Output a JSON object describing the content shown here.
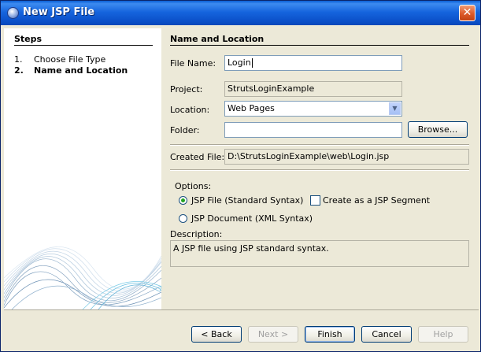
{
  "window": {
    "title": "New JSP File",
    "close_label": "✕"
  },
  "steps": {
    "title": "Steps",
    "items": [
      {
        "num": "1.",
        "label": "Choose File Type"
      },
      {
        "num": "2.",
        "label": "Name and Location"
      }
    ]
  },
  "form": {
    "section_title": "Name and Location",
    "file_name_label": "File Name:",
    "file_name_value": "Login",
    "project_label": "Project:",
    "project_value": "StrutsLoginExample",
    "location_label": "Location:",
    "location_value": "Web Pages",
    "folder_label": "Folder:",
    "folder_value": "",
    "browse_label": "Browse...",
    "created_file_label": "Created File:",
    "created_file_value": "D:\\StrutsLoginExample\\web\\Login.jsp",
    "options_label": "Options:",
    "radio_jsp_file": "JSP File (Standard Syntax)",
    "radio_jsp_document": "JSP Document (XML Syntax)",
    "check_segment": "Create as a JSP Segment",
    "description_label": "Description:",
    "description_value": "A JSP file using JSP standard syntax."
  },
  "buttons": {
    "back": "< Back",
    "next": "Next >",
    "finish": "Finish",
    "cancel": "Cancel",
    "help": "Help"
  },
  "icons": {
    "window_icon": "jsp-file-icon",
    "dropdown": "chevron-down-icon"
  }
}
